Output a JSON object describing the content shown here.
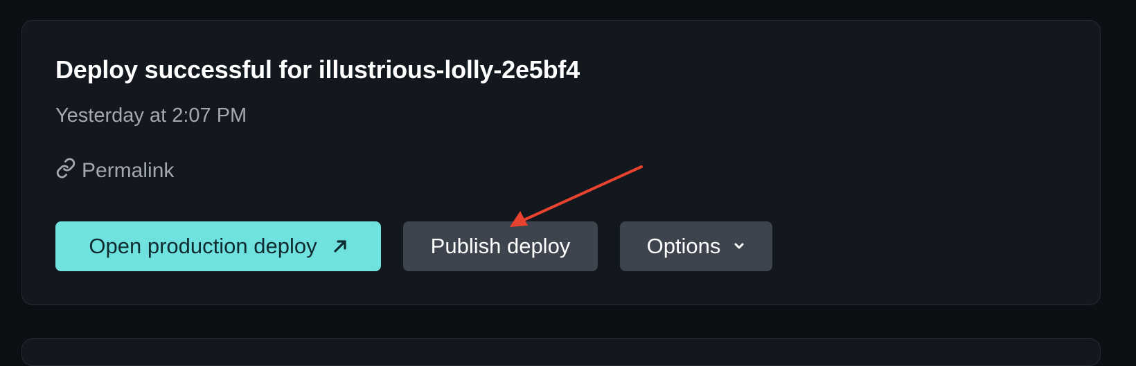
{
  "deploy": {
    "title": "Deploy successful for illustrious-lolly-2e5bf4",
    "timestamp": "Yesterday at 2:07 PM",
    "permalink_label": "Permalink"
  },
  "actions": {
    "open_production_label": "Open production deploy",
    "publish_label": "Publish deploy",
    "options_label": "Options"
  },
  "icons": {
    "permalink": "link-icon",
    "open_production": "arrow-up-right-icon",
    "options": "chevron-down-icon",
    "annotation": "red-arrow-annotation"
  },
  "colors": {
    "primary_button": "#6fe2e0",
    "secondary_button": "#3e444d",
    "annotation_arrow": "#e8432e"
  }
}
